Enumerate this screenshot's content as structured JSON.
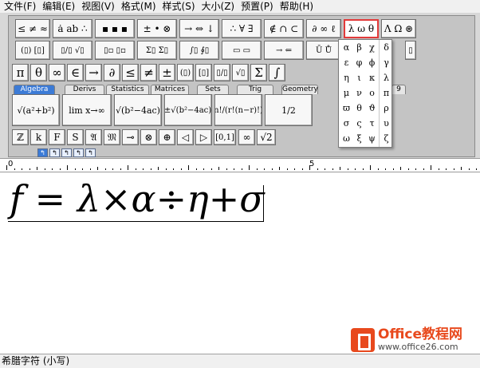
{
  "menu": [
    "文件(F)",
    "编辑(E)",
    "视图(V)",
    "格式(M)",
    "样式(S)",
    "大小(Z)",
    "预置(P)",
    "帮助(H)"
  ],
  "palette_row1": [
    "≤ ≠ ≈",
    "ȧ ab ∴",
    "▪ ▪ ▪",
    "± • ⊗",
    "→ ⇔ ↓",
    "∴ ∀ ∃",
    "∉ ∩ ⊂",
    "∂ ∞ ℓ",
    "λ ω θ",
    "Λ Ω ⊛"
  ],
  "palette_row2": [
    "(▯) [▯]",
    "▯/▯ √▯",
    "▯▫ ▯▫",
    "Σ▯ Σ▯",
    "∫▯ ∮▯",
    "▭ ▭",
    "→ ⇐",
    "Ū Ů",
    "▯▯ ▯▯",
    "▯"
  ],
  "palette_row3": [
    "π",
    "θ",
    "∞",
    "∈",
    "→",
    "∂",
    "≤",
    "≠",
    "±",
    "(▯)",
    "[▯]",
    "▯/▯",
    "√▯",
    "Σ",
    "∫"
  ],
  "tabs": [
    "Algebra",
    "Derivs",
    "Statistics",
    "Matrices",
    "Sets",
    "Trig",
    "Geometry",
    "9"
  ],
  "templates": [
    "√(a²+b²)",
    "lim x→∞",
    "√(b²−4ac)",
    "(−b±√(b²−4ac))/2a",
    "n!/(r!(n−r)!)",
    "1/2"
  ],
  "palette_row5": [
    "ℤ",
    "k",
    "F",
    "S",
    "𝔄",
    "𝔐",
    "⊸",
    "⊗",
    "⊕",
    "◁",
    "▷",
    "[0,1]",
    "∞",
    "√2"
  ],
  "greek": [
    "α",
    "β",
    "χ",
    "δ",
    "ε",
    "φ",
    "ϕ",
    "γ",
    "η",
    "ι",
    "κ",
    "λ",
    "μ",
    "ν",
    "ο",
    "π",
    "ϖ",
    "θ",
    "ϑ",
    "ρ",
    "σ",
    "ς",
    "τ",
    "υ",
    "ω",
    "ξ",
    "ψ",
    "ζ"
  ],
  "ruler": {
    "start": "0",
    "mid": "5"
  },
  "equation": {
    "f": "f",
    "eq": "=",
    "lambda": "λ",
    "times": "×",
    "alpha": "α",
    "div": "÷",
    "eta": "η",
    "plus": "+",
    "sigma": "σ"
  },
  "logo": {
    "title": "Office教程网",
    "url": "www.office26.com"
  },
  "status": "希腊字符 (小写)",
  "colors": {
    "accent": "#e8491d",
    "tab_selected": "#3c7bd6",
    "active_border": "#e23a3a"
  }
}
